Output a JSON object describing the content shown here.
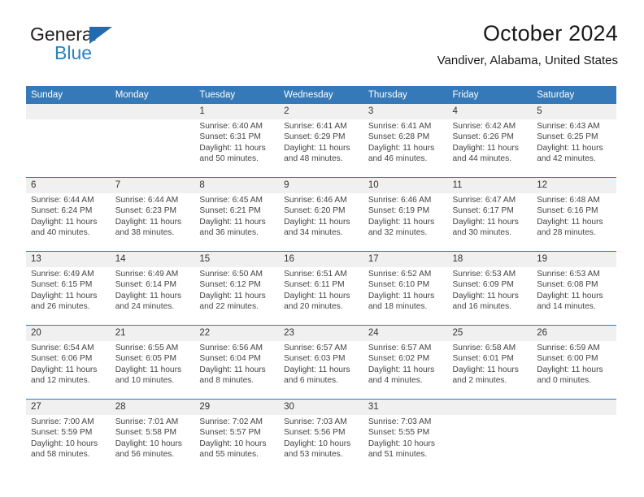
{
  "brand": {
    "name_primary": "General",
    "name_secondary": "Blue",
    "accent_color": "#2483c5",
    "triangle_color": "#1f6cb4"
  },
  "header": {
    "title": "October 2024",
    "subtitle": "Vandiver, Alabama, United States"
  },
  "calendar": {
    "header_color": "#3579b8",
    "daynum_band_color": "#f0f0f0",
    "weekday_headers": [
      "Sunday",
      "Monday",
      "Tuesday",
      "Wednesday",
      "Thursday",
      "Friday",
      "Saturday"
    ],
    "weeks": [
      [
        {
          "day": "",
          "empty": true
        },
        {
          "day": "",
          "empty": true
        },
        {
          "day": "1",
          "sunrise": "Sunrise: 6:40 AM",
          "sunset": "Sunset: 6:31 PM",
          "daylight_line1": "Daylight: 11 hours",
          "daylight_line2": "and 50 minutes."
        },
        {
          "day": "2",
          "sunrise": "Sunrise: 6:41 AM",
          "sunset": "Sunset: 6:29 PM",
          "daylight_line1": "Daylight: 11 hours",
          "daylight_line2": "and 48 minutes."
        },
        {
          "day": "3",
          "sunrise": "Sunrise: 6:41 AM",
          "sunset": "Sunset: 6:28 PM",
          "daylight_line1": "Daylight: 11 hours",
          "daylight_line2": "and 46 minutes."
        },
        {
          "day": "4",
          "sunrise": "Sunrise: 6:42 AM",
          "sunset": "Sunset: 6:26 PM",
          "daylight_line1": "Daylight: 11 hours",
          "daylight_line2": "and 44 minutes."
        },
        {
          "day": "5",
          "sunrise": "Sunrise: 6:43 AM",
          "sunset": "Sunset: 6:25 PM",
          "daylight_line1": "Daylight: 11 hours",
          "daylight_line2": "and 42 minutes."
        }
      ],
      [
        {
          "day": "6",
          "sunrise": "Sunrise: 6:44 AM",
          "sunset": "Sunset: 6:24 PM",
          "daylight_line1": "Daylight: 11 hours",
          "daylight_line2": "and 40 minutes."
        },
        {
          "day": "7",
          "sunrise": "Sunrise: 6:44 AM",
          "sunset": "Sunset: 6:23 PM",
          "daylight_line1": "Daylight: 11 hours",
          "daylight_line2": "and 38 minutes."
        },
        {
          "day": "8",
          "sunrise": "Sunrise: 6:45 AM",
          "sunset": "Sunset: 6:21 PM",
          "daylight_line1": "Daylight: 11 hours",
          "daylight_line2": "and 36 minutes."
        },
        {
          "day": "9",
          "sunrise": "Sunrise: 6:46 AM",
          "sunset": "Sunset: 6:20 PM",
          "daylight_line1": "Daylight: 11 hours",
          "daylight_line2": "and 34 minutes."
        },
        {
          "day": "10",
          "sunrise": "Sunrise: 6:46 AM",
          "sunset": "Sunset: 6:19 PM",
          "daylight_line1": "Daylight: 11 hours",
          "daylight_line2": "and 32 minutes."
        },
        {
          "day": "11",
          "sunrise": "Sunrise: 6:47 AM",
          "sunset": "Sunset: 6:17 PM",
          "daylight_line1": "Daylight: 11 hours",
          "daylight_line2": "and 30 minutes."
        },
        {
          "day": "12",
          "sunrise": "Sunrise: 6:48 AM",
          "sunset": "Sunset: 6:16 PM",
          "daylight_line1": "Daylight: 11 hours",
          "daylight_line2": "and 28 minutes."
        }
      ],
      [
        {
          "day": "13",
          "sunrise": "Sunrise: 6:49 AM",
          "sunset": "Sunset: 6:15 PM",
          "daylight_line1": "Daylight: 11 hours",
          "daylight_line2": "and 26 minutes."
        },
        {
          "day": "14",
          "sunrise": "Sunrise: 6:49 AM",
          "sunset": "Sunset: 6:14 PM",
          "daylight_line1": "Daylight: 11 hours",
          "daylight_line2": "and 24 minutes."
        },
        {
          "day": "15",
          "sunrise": "Sunrise: 6:50 AM",
          "sunset": "Sunset: 6:12 PM",
          "daylight_line1": "Daylight: 11 hours",
          "daylight_line2": "and 22 minutes."
        },
        {
          "day": "16",
          "sunrise": "Sunrise: 6:51 AM",
          "sunset": "Sunset: 6:11 PM",
          "daylight_line1": "Daylight: 11 hours",
          "daylight_line2": "and 20 minutes."
        },
        {
          "day": "17",
          "sunrise": "Sunrise: 6:52 AM",
          "sunset": "Sunset: 6:10 PM",
          "daylight_line1": "Daylight: 11 hours",
          "daylight_line2": "and 18 minutes."
        },
        {
          "day": "18",
          "sunrise": "Sunrise: 6:53 AM",
          "sunset": "Sunset: 6:09 PM",
          "daylight_line1": "Daylight: 11 hours",
          "daylight_line2": "and 16 minutes."
        },
        {
          "day": "19",
          "sunrise": "Sunrise: 6:53 AM",
          "sunset": "Sunset: 6:08 PM",
          "daylight_line1": "Daylight: 11 hours",
          "daylight_line2": "and 14 minutes."
        }
      ],
      [
        {
          "day": "20",
          "sunrise": "Sunrise: 6:54 AM",
          "sunset": "Sunset: 6:06 PM",
          "daylight_line1": "Daylight: 11 hours",
          "daylight_line2": "and 12 minutes."
        },
        {
          "day": "21",
          "sunrise": "Sunrise: 6:55 AM",
          "sunset": "Sunset: 6:05 PM",
          "daylight_line1": "Daylight: 11 hours",
          "daylight_line2": "and 10 minutes."
        },
        {
          "day": "22",
          "sunrise": "Sunrise: 6:56 AM",
          "sunset": "Sunset: 6:04 PM",
          "daylight_line1": "Daylight: 11 hours",
          "daylight_line2": "and 8 minutes."
        },
        {
          "day": "23",
          "sunrise": "Sunrise: 6:57 AM",
          "sunset": "Sunset: 6:03 PM",
          "daylight_line1": "Daylight: 11 hours",
          "daylight_line2": "and 6 minutes."
        },
        {
          "day": "24",
          "sunrise": "Sunrise: 6:57 AM",
          "sunset": "Sunset: 6:02 PM",
          "daylight_line1": "Daylight: 11 hours",
          "daylight_line2": "and 4 minutes."
        },
        {
          "day": "25",
          "sunrise": "Sunrise: 6:58 AM",
          "sunset": "Sunset: 6:01 PM",
          "daylight_line1": "Daylight: 11 hours",
          "daylight_line2": "and 2 minutes."
        },
        {
          "day": "26",
          "sunrise": "Sunrise: 6:59 AM",
          "sunset": "Sunset: 6:00 PM",
          "daylight_line1": "Daylight: 11 hours",
          "daylight_line2": "and 0 minutes."
        }
      ],
      [
        {
          "day": "27",
          "sunrise": "Sunrise: 7:00 AM",
          "sunset": "Sunset: 5:59 PM",
          "daylight_line1": "Daylight: 10 hours",
          "daylight_line2": "and 58 minutes."
        },
        {
          "day": "28",
          "sunrise": "Sunrise: 7:01 AM",
          "sunset": "Sunset: 5:58 PM",
          "daylight_line1": "Daylight: 10 hours",
          "daylight_line2": "and 56 minutes."
        },
        {
          "day": "29",
          "sunrise": "Sunrise: 7:02 AM",
          "sunset": "Sunset: 5:57 PM",
          "daylight_line1": "Daylight: 10 hours",
          "daylight_line2": "and 55 minutes."
        },
        {
          "day": "30",
          "sunrise": "Sunrise: 7:03 AM",
          "sunset": "Sunset: 5:56 PM",
          "daylight_line1": "Daylight: 10 hours",
          "daylight_line2": "and 53 minutes."
        },
        {
          "day": "31",
          "sunrise": "Sunrise: 7:03 AM",
          "sunset": "Sunset: 5:55 PM",
          "daylight_line1": "Daylight: 10 hours",
          "daylight_line2": "and 51 minutes."
        },
        {
          "day": "",
          "empty": true
        },
        {
          "day": "",
          "empty": true
        }
      ]
    ]
  }
}
